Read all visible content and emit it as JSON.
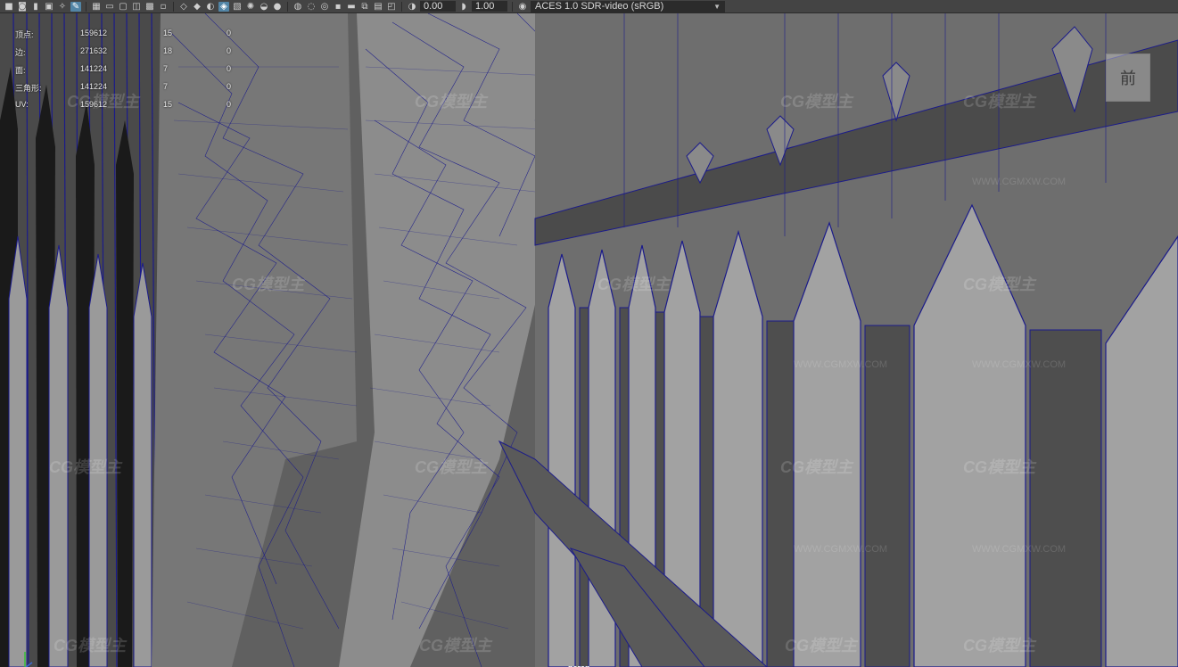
{
  "toolbar": {
    "icons": [
      "camera-icon",
      "camera-attr-icon",
      "bookmark-icon",
      "image-plane-icon",
      "grid-icon",
      "film-gate-icon",
      "resolution-gate-icon",
      "gate-mask-icon",
      "field-chart-icon",
      "safe-action-icon",
      "wireframe-icon",
      "smooth-shade-icon",
      "default-material-icon",
      "textured-icon",
      "lights-icon",
      "shadows-icon",
      "ambient-occlusion-icon",
      "motion-blur-icon",
      "anti-alias-icon",
      "depth-of-field-icon",
      "isolate-icon",
      "xray-icon",
      "xray-joints-icon",
      "xray-components-icon",
      "exposure-icon"
    ],
    "exposure_value": "0.00",
    "gamma_value": "1.00",
    "colorspace": "ACES 1.0 SDR-video (sRGB)"
  },
  "hud": {
    "rows": [
      {
        "label": "顶点:",
        "v1": "159612",
        "v2": "15",
        "v3": "0"
      },
      {
        "label": "边:",
        "v1": "271632",
        "v2": "18",
        "v3": "0"
      },
      {
        "label": "面:",
        "v1": "141224",
        "v2": "7",
        "v3": "0"
      },
      {
        "label": "三角形:",
        "v1": "141224",
        "v2": "7",
        "v3": "0"
      },
      {
        "label": "UV:",
        "v1": "159612",
        "v2": "15",
        "v3": "0"
      }
    ]
  },
  "view_cube": {
    "label": "前"
  },
  "camera_label": "persp",
  "watermark": {
    "text": "CG模型主",
    "url": "WWW.CGMXW.COM"
  },
  "colors": {
    "wire": "#1a1a7a",
    "surface": "#8a8a8a",
    "dark": "#3c3c3c",
    "accent": "#5285a6"
  }
}
